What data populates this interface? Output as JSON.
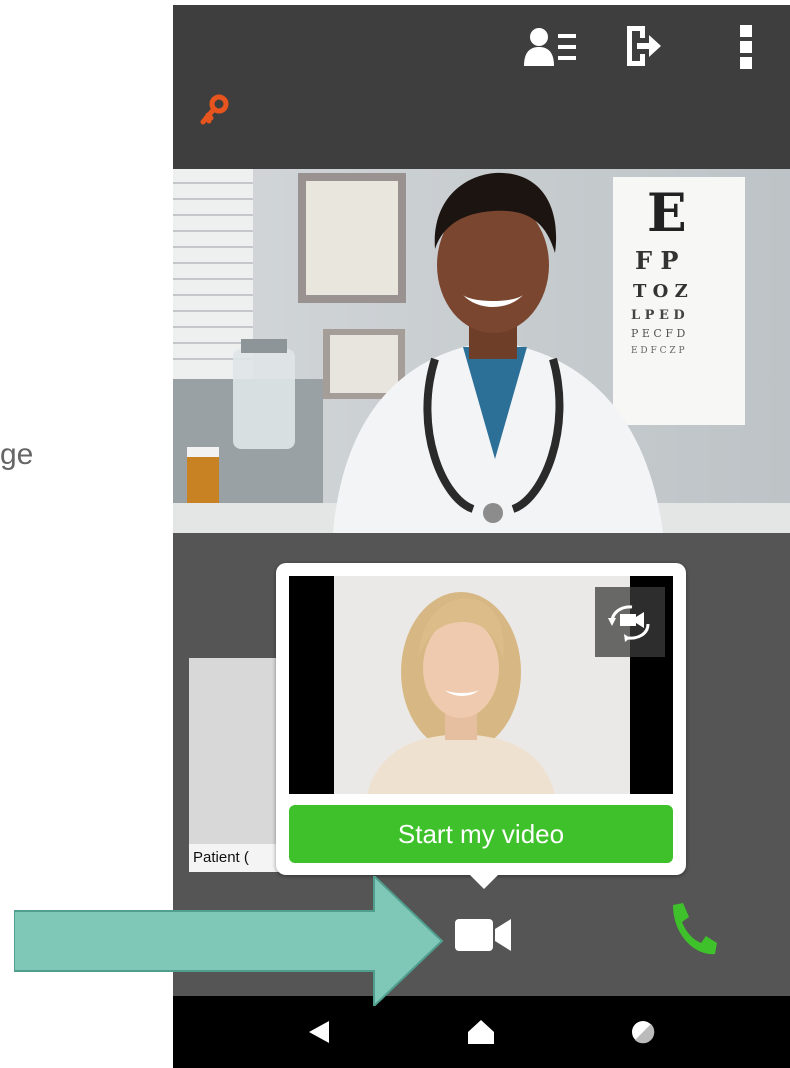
{
  "background": {
    "text": "ge"
  },
  "patient_tile": {
    "label": "Patient ("
  },
  "self_view": {
    "start_video_label": "Start my video"
  },
  "colors": {
    "accent_green": "#3ec12a",
    "key_orange": "#e8541d",
    "arrow_teal": "#7fc8b8",
    "topbar": "#3e3e3e",
    "phone_bg": "#555555"
  },
  "icons": {
    "topbar": [
      "participants-icon",
      "exit-icon",
      "more-options-icon"
    ],
    "status": "key-icon",
    "call_bar": [
      "microphone-icon",
      "camera-icon",
      "phone-icon"
    ],
    "nav": [
      "back-icon",
      "home-icon",
      "recents-icon"
    ],
    "preview": "switch-camera-icon"
  }
}
